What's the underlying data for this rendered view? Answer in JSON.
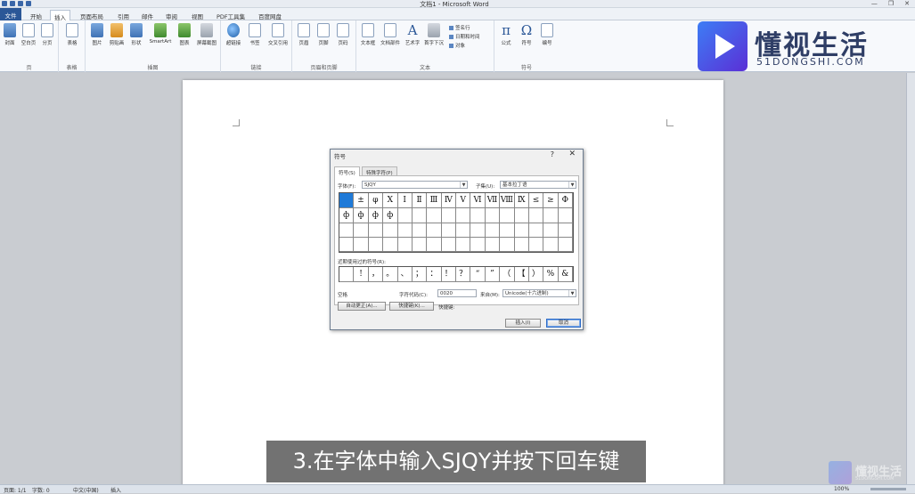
{
  "window": {
    "title": "文档1 - Microsoft Word",
    "controls": [
      "—",
      "❐",
      "✕"
    ]
  },
  "tabs": [
    "文件",
    "开始",
    "插入",
    "页面布局",
    "引用",
    "邮件",
    "审阅",
    "视图",
    "PDF工具集",
    "百度网盘"
  ],
  "ribbon": {
    "groups": [
      {
        "label": "页",
        "buttons": [
          "封面",
          "空白页",
          "分页"
        ]
      },
      {
        "label": "表格",
        "buttons": [
          "表格"
        ]
      },
      {
        "label": "插图",
        "buttons": [
          "图片",
          "剪贴画",
          "形状",
          "SmartArt",
          "图表",
          "屏幕截图"
        ]
      },
      {
        "label": "链接",
        "buttons": [
          "超链接",
          "书签",
          "交叉引用"
        ]
      },
      {
        "label": "页眉和页脚",
        "buttons": [
          "页眉",
          "页脚",
          "页码"
        ]
      },
      {
        "label": "文本",
        "buttons": [
          "文本框",
          "文档部件",
          "艺术字",
          "首字下沉"
        ],
        "small": [
          "签名行",
          "日期和时间",
          "对象"
        ]
      },
      {
        "label": "符号",
        "buttons": [
          "公式",
          "符号",
          "编号"
        ]
      }
    ]
  },
  "brand": {
    "name": "懂视生活",
    "url": "51DONGSHI.COM"
  },
  "dialog": {
    "title": "符号",
    "help": "?",
    "close": "✕",
    "tab_symbols": "符号(S)",
    "tab_special": "特殊字符(P)",
    "font_label": "字体(F):",
    "font_value": "SJQY",
    "subset_label": "子集(U):",
    "subset_value": "基本拉丁语",
    "grid_symbols": [
      "",
      "±",
      "φ",
      "X",
      "Ⅰ",
      "Ⅱ",
      "Ⅲ",
      "Ⅳ",
      "Ⅴ",
      "Ⅵ",
      "Ⅶ",
      "Ⅷ",
      "Ⅸ",
      "≤",
      "≥",
      "Φ",
      "ф",
      "ф",
      "ф",
      "ф",
      "",
      "",
      "",
      "",
      "",
      "",
      "",
      "",
      "",
      "",
      "",
      "",
      "",
      "",
      "",
      "",
      "",
      "",
      "",
      "",
      "",
      "",
      "",
      "",
      "",
      "",
      "",
      "",
      "",
      "",
      "",
      "",
      "",
      "",
      "",
      "",
      "",
      "",
      "",
      "",
      "",
      "",
      "",
      ""
    ],
    "recent_label": "近期使用过的符号(R):",
    "recent_symbols": [
      "",
      "!",
      "，",
      "。",
      "、",
      "；",
      "：",
      "！",
      "？",
      "“",
      "”",
      "（",
      "【",
      "）",
      "%",
      "&"
    ],
    "char_name": "空格",
    "code_label": "字符代码(C):",
    "code_value": "0020",
    "from_label": "来自(M):",
    "from_value": "Unicode(十六进制)",
    "autocorrect_button": "自动更正(A)...",
    "shortcut_button": "快捷键(K)...",
    "shortcut_label": "快捷键:",
    "insert_button": "插入(I)",
    "cancel_button": "取消"
  },
  "status": {
    "page": "页面: 1/1",
    "words": "字数: 0",
    "lang": "中文(中国)",
    "mode": "插入",
    "zoom": "100%"
  },
  "caption": "3.在字体中输入SJQY并按下回车键",
  "watermark": {
    "name": "懂视生活",
    "url": "51DONGSHI.COM"
  }
}
